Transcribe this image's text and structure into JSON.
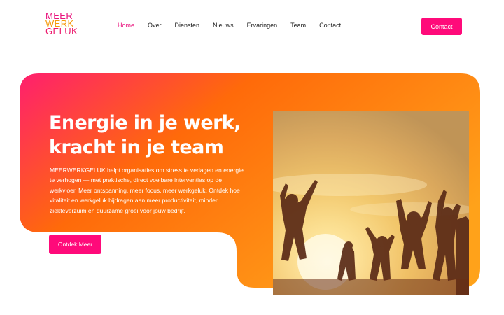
{
  "logo": {
    "line1": "MEER",
    "line2": "WERK",
    "line3": "GELUK"
  },
  "nav": {
    "items": [
      {
        "label": "Home"
      },
      {
        "label": "Over"
      },
      {
        "label": "Diensten"
      },
      {
        "label": "Nieuws"
      },
      {
        "label": "Ervaringen"
      },
      {
        "label": "Team"
      },
      {
        "label": "Contact"
      }
    ],
    "active": "Home"
  },
  "header": {
    "cta_label": "Contact"
  },
  "hero": {
    "title_line1": "Energie in je werk,",
    "title_line2": "kracht in je team",
    "body": "MEERWERKGELUK helpt organisaties om stress te verlagen en energie te verhogen — met praktische, direct voelbare interventies op de werkvloer. Meer ontspanning, meer focus, meer werkgeluk. Ontdek hoe vitaliteit en werkgeluk bijdragen aan meer productiviteit, minder ziekteverzuim en duurzame groei voor jouw bedrijf.",
    "button_label": "Ontdek Meer"
  },
  "colors": {
    "accent": "#ff0a7a",
    "hero_gradient_start": "#ff1f6e",
    "hero_gradient_mid": "#ff6a0a",
    "hero_gradient_end": "#ffa21a"
  }
}
